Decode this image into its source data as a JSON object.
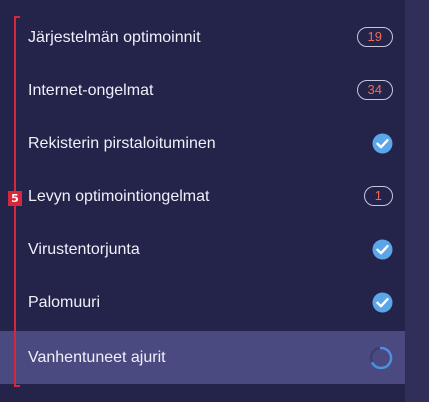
{
  "marker": "5",
  "items": [
    {
      "label": "Järjestelmän optimoinnit",
      "status": "count",
      "count": "19"
    },
    {
      "label": "Internet-ongelmat",
      "status": "count",
      "count": "34"
    },
    {
      "label": "Rekisterin pirstaloituminen",
      "status": "done",
      "icon": "check-circle-icon"
    },
    {
      "label": "Levyn optimointiongelmat",
      "status": "count",
      "count": "1"
    },
    {
      "label": "Virustentorjunta",
      "status": "done",
      "icon": "check-circle-icon"
    },
    {
      "label": "Palomuuri",
      "status": "done",
      "icon": "check-circle-icon"
    },
    {
      "label": "Vanhentuneet ajurit",
      "status": "scanning",
      "icon": "spinner-icon"
    }
  ],
  "colors": {
    "background": "#24234a",
    "active_row": "#4a4a80",
    "accent_red": "#d6283a",
    "count_text": "#f06a5a",
    "check_blue": "#5aa6e8"
  }
}
